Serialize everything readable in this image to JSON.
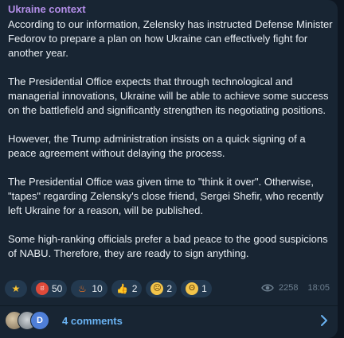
{
  "post": {
    "channel_name": "Ukraine context",
    "paragraphs": [
      "According to our information, Zelensky has instructed Defense Minister Fedorov to prepare a plan on how Ukraine can effectively fight for another year.",
      "The Presidential Office expects that through technological and managerial innovations, Ukraine will be able to achieve some success on the battlefield and significantly strengthen its negotiating positions.",
      "However, the Trump administration insists on a quick signing of a peace agreement without delaying the process.",
      "The Presidential Office was given time to \"think it over\". Otherwise, \"tapes\" regarding Zelensky's close friend, Sergei Shefir, who recently left Ukraine for a reason, will be published.",
      "Some high-ranking officials prefer a bad peace to the good suspicions of NABU. Therefore, they are ready to sign anything."
    ],
    "reactions": [
      {
        "icon": "star-icon",
        "count": ""
      },
      {
        "icon": "angry-face-icon",
        "count": "50"
      },
      {
        "icon": "fire-icon",
        "count": "10"
      },
      {
        "icon": "thumbs-up-icon",
        "count": "2"
      },
      {
        "icon": "crying-face-icon",
        "count": "2"
      },
      {
        "icon": "screaming-face-icon",
        "count": "1"
      }
    ],
    "views": "2258",
    "time": "18:05"
  },
  "comments": {
    "avatar_initial": "D",
    "label": "4 comments"
  },
  "colors": {
    "background": "#0e1621",
    "bubble": "#182533",
    "channel_name": "#b38ee8",
    "link": "#6ab3f3",
    "meta": "#6d7f8f"
  }
}
